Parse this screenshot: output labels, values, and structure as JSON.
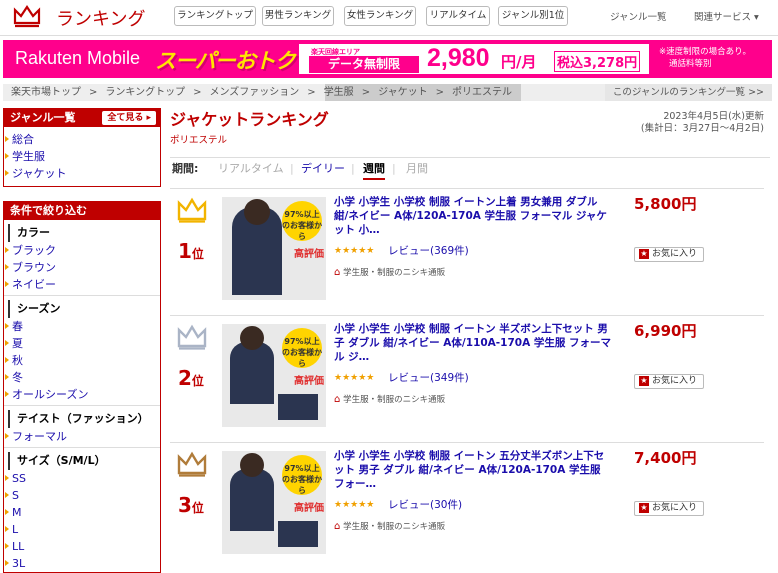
{
  "header": {
    "title": "ランキング",
    "nav": [
      "ランキングトップ",
      "男性ランキング",
      "女性ランキング",
      "リアルタイム",
      "ジャンル別1位"
    ],
    "genre_list": "ジャンル一覧",
    "related": "関連サービス ▾"
  },
  "banner": {
    "brand": "Rakuten Mobile",
    "headline": "スーパーおトク",
    "area": "楽天回線エリア",
    "badge": "データ無制限",
    "price": "2,980",
    "unit": "円/月",
    "tax": "税込3,278円",
    "note1": "※速度制限の場合あり。",
    "note2": "通話料等別"
  },
  "breadcrumb": {
    "items": [
      "楽天市場トップ",
      ">",
      "ランキングトップ",
      ">",
      "メンズファッション",
      ">",
      "学生服",
      ">",
      "ジャケット",
      ">",
      "ポリエステル"
    ],
    "right": "このジャンルのランキング一覧 >>"
  },
  "sidebar": {
    "genre_title": "ジャンル一覧",
    "all_btn": "全て見る",
    "genres": [
      "総合",
      "学生服",
      "ジャケット"
    ],
    "filter_title": "条件で絞り込む",
    "sections": [
      {
        "title": "カラー",
        "items": [
          "ブラック",
          "ブラウン",
          "ネイビー"
        ]
      },
      {
        "title": "シーズン",
        "items": [
          "春",
          "夏",
          "秋",
          "冬",
          "オールシーズン"
        ]
      },
      {
        "title": "テイスト（ファッション）",
        "items": [
          "フォーマル"
        ]
      },
      {
        "title": "サイズ（S/M/L）",
        "items": [
          "SS",
          "S",
          "M",
          "L",
          "LL",
          "3L"
        ]
      }
    ]
  },
  "main": {
    "title": "ジャケットランキング",
    "subtitle": "ポリエステル",
    "update_date": "2023年4月5日(水)更新",
    "update_range": "(集計日：3月27日～4月2日)",
    "period_label": "期間:",
    "periods": [
      "リアルタイム",
      "|",
      "デイリー",
      "|",
      "週間",
      "|",
      "月間"
    ],
    "items": [
      {
        "rank": "1",
        "rank_suffix": "位",
        "title": "小学 小学生 小学校 制服 イートン上着 男女兼用 ダブル 紺/ネイビー A体/120A-170A 学生服 フォーマル ジャケット 小…",
        "stars": "★★★★★",
        "review": "レビュー(369件)",
        "shop": "学生服・制服のニシキ通販",
        "price": "5,800円",
        "fav": "お気に入り",
        "photo_badge": "97%以上のお客様から",
        "photo_label": "高評価",
        "crown_color": "#f2b400"
      },
      {
        "rank": "2",
        "rank_suffix": "位",
        "title": "小学 小学生 小学校 制服 イートン 半ズボン上下セット 男子 ダブル 紺/ネイビー A体/110A-170A 学生服 フォーマル ジ…",
        "stars": "★★★★★",
        "review": "レビュー(349件)",
        "shop": "学生服・制服のニシキ通販",
        "price": "6,990円",
        "fav": "お気に入り",
        "photo_badge": "97%以上のお客様から",
        "photo_label": "高評価",
        "crown_color": "#aab4c6"
      },
      {
        "rank": "3",
        "rank_suffix": "位",
        "title": "小学 小学生 小学校 制服 イートン 五分丈半ズボン上下セット 男子 ダブル 紺/ネイビー A体/120A-170A 学生服 フォー…",
        "stars": "★★★★★",
        "review": "レビュー(30件)",
        "shop": "学生服・制服のニシキ通販",
        "price": "7,400円",
        "fav": "お気に入り",
        "photo_badge": "97%以上のお客様から",
        "photo_label": "高評価",
        "crown_color": "#b07c3a"
      }
    ]
  }
}
